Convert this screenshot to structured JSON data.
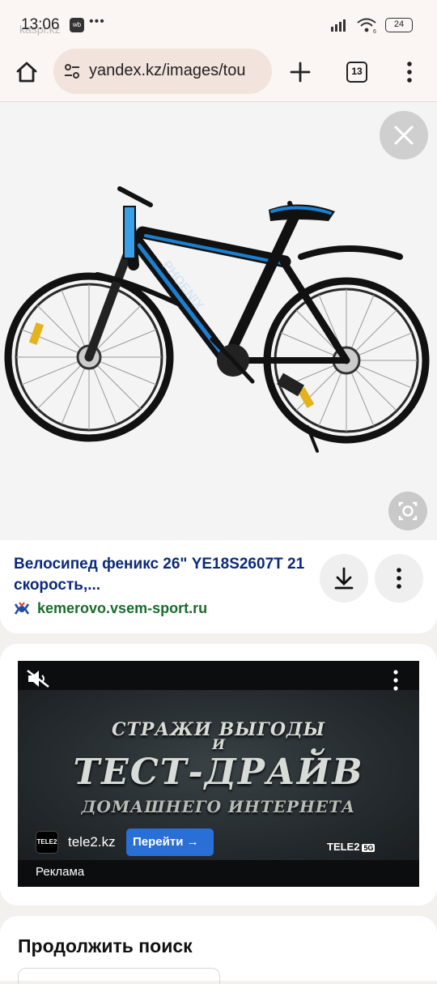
{
  "status_bar": {
    "time": "13:06",
    "app_badge": "wb",
    "dots": "•••",
    "ghost_text": "kaspi.kz",
    "battery": "24",
    "network_generation": "6"
  },
  "browser": {
    "url": "yandex.kz/images/tou",
    "tab_count": "13"
  },
  "result": {
    "title": "Велосипед феникс 26\" YE18S2607T 21 скорость,...",
    "source": "kemerovo.vsem-sport.ru",
    "frame_brand": "PHOENIX"
  },
  "ad": {
    "line1": "СТРАЖИ ВЫГОДЫ",
    "line2": "И",
    "line3": "ТЕСТ-ДРАЙВ",
    "line4": "ДОМАШНЕГО ИНТЕРНЕТА",
    "brand_logo": "TELE2",
    "brand_5g": "5G",
    "advertiser_logo": "TELE2",
    "advertiser": "tele2.kz",
    "go_button": "Перейти →",
    "label": "Реклама"
  },
  "continue": {
    "title": "Продолжить поиск"
  },
  "colors": {
    "title": "#0b2a7a",
    "source": "#1a6b2c",
    "go_button": "#2a6fd6",
    "bike_accent": "#1d7fd0"
  }
}
